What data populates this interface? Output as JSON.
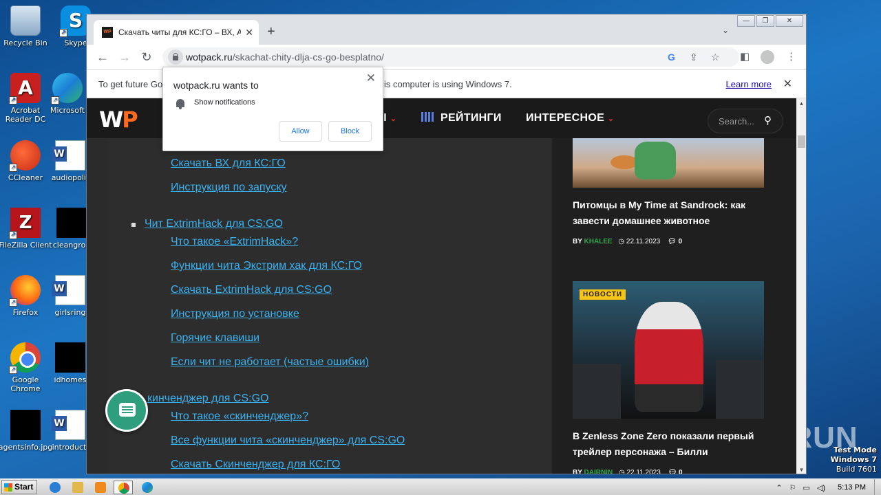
{
  "desktop": {
    "icons": [
      {
        "label": "Recycle Bin"
      },
      {
        "label": "Skype"
      },
      {
        "label": "Acrobat Reader DC"
      },
      {
        "label": "Microsoft"
      },
      {
        "label": "CCleaner"
      },
      {
        "label": "audiopolit"
      },
      {
        "label": "FileZilla Client"
      },
      {
        "label": "cleangrou"
      },
      {
        "label": "Firefox"
      },
      {
        "label": "girlsring"
      },
      {
        "label": "Google Chrome"
      },
      {
        "label": "idhomes"
      },
      {
        "label": "agentsinfo.jpg"
      },
      {
        "label": "introducti"
      }
    ],
    "watermark": "ANY  RUN",
    "test_mode": [
      "Test Mode",
      "Windows 7",
      "Build 7601"
    ]
  },
  "browser": {
    "tab_title": "Скачать читы для КС:ГО – ВХ, АИ",
    "tab_favicon": "WP",
    "url_host": "wotpack.ru",
    "url_path": "/skachat-chity-dlja-cs-go-besplatno/",
    "infobar": {
      "text": "To get future Go",
      "text_tail": "is computer is using Windows 7.",
      "link": "Learn more"
    }
  },
  "notification": {
    "heading": "wotpack.ru wants to",
    "permission": "Show notifications",
    "allow": "Allow",
    "block": "Block"
  },
  "site": {
    "logo_w": "W",
    "logo_p": "P",
    "nav": [
      {
        "label": "Ы"
      },
      {
        "label": "РЕЙТИНГИ"
      },
      {
        "label": "ИНТЕРЕСНОЕ"
      }
    ],
    "search_placeholder": "Search...",
    "toc": {
      "items_top": [
        "Скачать ВХ для КС:ГО",
        "Инструкция по запуску"
      ],
      "section2": "Чит ExtrimHack для CS:GO",
      "items2": [
        "Что такое «ExtrimHack»?",
        "Функции чита Экстрим хак для КС:ГО",
        "Скачать ExtrimHack для CS:GO",
        "Инструкция по установке",
        "Горячие клавиши",
        "Если чит не работает (частые ошибки)"
      ],
      "section3": "кинченджер для CS:GO",
      "items3": [
        "Что такое «скинченджер»?",
        "Все функции чита «скинченджер» для CS:GO",
        "Скачать Скинченджер для КС:ГО"
      ]
    },
    "sidebar": {
      "post1": {
        "title": "Питомцы в My Time at Sandrock: как завести домашнее животное",
        "by": "BY",
        "author": "KHALEE",
        "date": "22.11.2023",
        "comments": "0"
      },
      "post2": {
        "badge": "НОВОСТИ",
        "title": "В Zenless Zone Zero показали первый трейлер персонажа – Билли",
        "by": "BY",
        "author": "DAIRNIN",
        "date": "22.11.2023",
        "comments": "0"
      }
    }
  },
  "taskbar": {
    "start": "Start",
    "clock": "5:13 PM"
  }
}
